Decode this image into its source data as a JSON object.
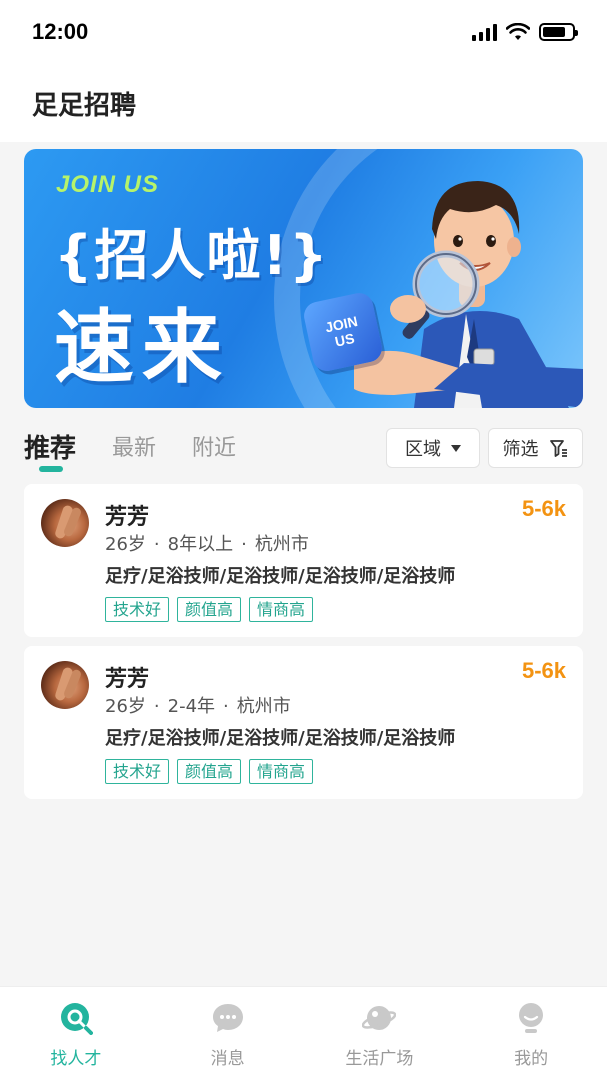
{
  "status_bar": {
    "time": "12:00"
  },
  "header": {
    "title": "足足招聘"
  },
  "banner": {
    "kicker": "JOIN US",
    "headline": "{招人啦!}",
    "subhead": "速来",
    "badge_line1": "JOIN",
    "badge_line2": "US"
  },
  "tabs": [
    {
      "label": "推荐",
      "active": true
    },
    {
      "label": "最新",
      "active": false
    },
    {
      "label": "附近",
      "active": false
    }
  ],
  "filters": {
    "area_label": "区域",
    "filter_label": "筛选"
  },
  "candidates": [
    {
      "name": "芳芳",
      "salary": "5-6k",
      "age": "26岁",
      "experience": "8年以上",
      "city": "杭州市",
      "jobs": "足疗/足浴技师/足浴技师/足浴技师/足浴技师",
      "tags": [
        "技术好",
        "颜值高",
        "情商高"
      ]
    },
    {
      "name": "芳芳",
      "salary": "5-6k",
      "age": "26岁",
      "experience": "2-4年",
      "city": "杭州市",
      "jobs": "足疗/足浴技师/足浴技师/足浴技师/足浴技师",
      "tags": [
        "技术好",
        "颜值高",
        "情商高"
      ]
    }
  ],
  "separator": "·",
  "bottom_nav": [
    {
      "label": "找人才",
      "icon": "find-talent-icon",
      "active": true
    },
    {
      "label": "消息",
      "icon": "message-icon",
      "active": false
    },
    {
      "label": "生活广场",
      "icon": "planet-icon",
      "active": false
    },
    {
      "label": "我的",
      "icon": "profile-icon",
      "active": false
    }
  ],
  "colors": {
    "accent": "#23b49e",
    "salary": "#f39312",
    "banner_blue": "#1f7de3"
  }
}
